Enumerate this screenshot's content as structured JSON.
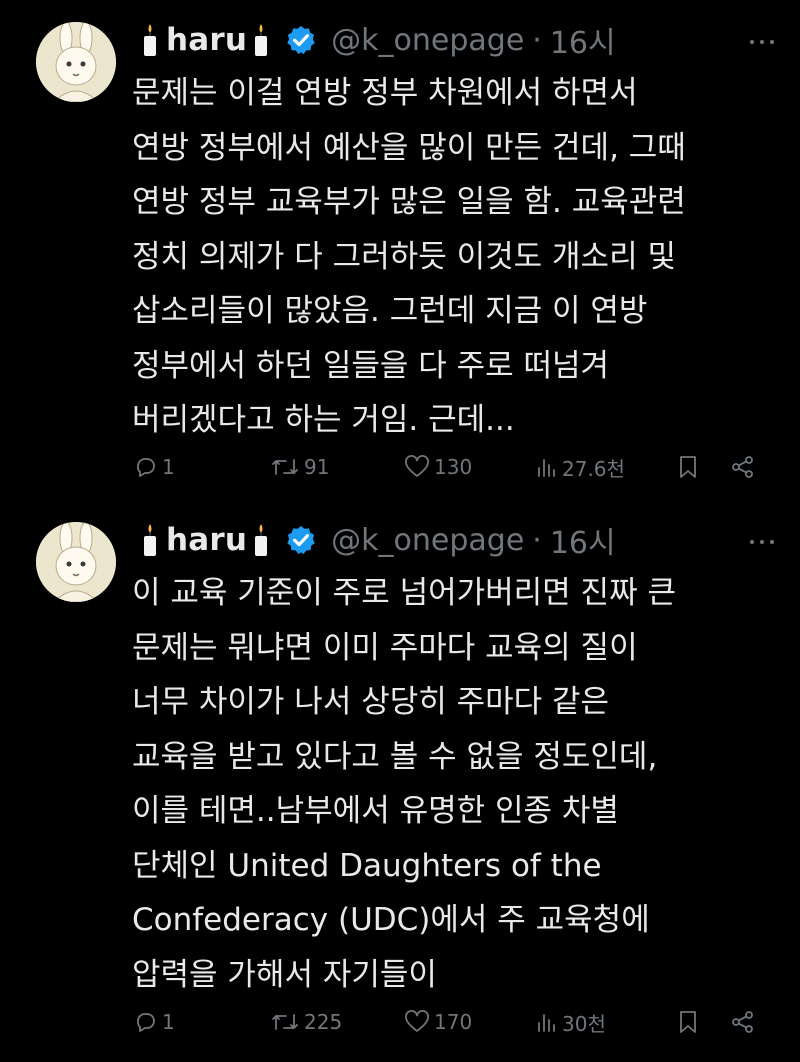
{
  "tweets": [
    {
      "name": "haru",
      "handle": "@k_onepage",
      "separator": "·",
      "time": "16시",
      "lines": [
        "문제는 이걸 연방 정부 차원에서 하면서",
        "연방 정부에서 예산을 많이 만든 건데, 그때",
        "연방 정부 교육부가 많은 일을 함. 교육관련",
        "정치 의제가 다 그러하듯 이것도 개소리 및",
        "삽소리들이 많았음. 그런데 지금 이 연방",
        "정부에서 하던 일들을 다 주로 떠넘겨",
        "버리겠다고 하는 거임. 근데..."
      ],
      "replies": "1",
      "retweets": "91",
      "likes": "130",
      "views": "27.6천"
    },
    {
      "name": "haru",
      "handle": "@k_onepage",
      "separator": "·",
      "time": "16시",
      "lines": [
        "이 교육 기준이 주로 넘어가버리면 진짜 큰",
        "문제는 뭐냐면 이미 주마다 교육의 질이",
        "너무 차이가 나서 상당히 주마다 같은",
        "교육을 받고 있다고 볼 수 없을 정도인데,",
        "이를 테면..남부에서 유명한 인종 차별",
        "단체인 United Daughters of the",
        "Confederacy (UDC)에서 주 교육청에",
        "압력을 가해서 자기들이"
      ],
      "replies": "1",
      "retweets": "225",
      "likes": "170",
      "views": "30천"
    }
  ],
  "icons": {
    "avatar": "rabbit-avatar-icon",
    "decoration": "candle-icon",
    "verified": "verified-badge-icon",
    "more": "more-icon",
    "reply": "reply-icon",
    "retweet": "retweet-icon",
    "like": "heart-icon",
    "views": "views-icon",
    "bookmark": "bookmark-icon",
    "share": "share-icon"
  },
  "colors": {
    "background": "#000000",
    "text": "#e7e9ea",
    "muted": "#71767b",
    "verified": "#1d9bf0"
  }
}
